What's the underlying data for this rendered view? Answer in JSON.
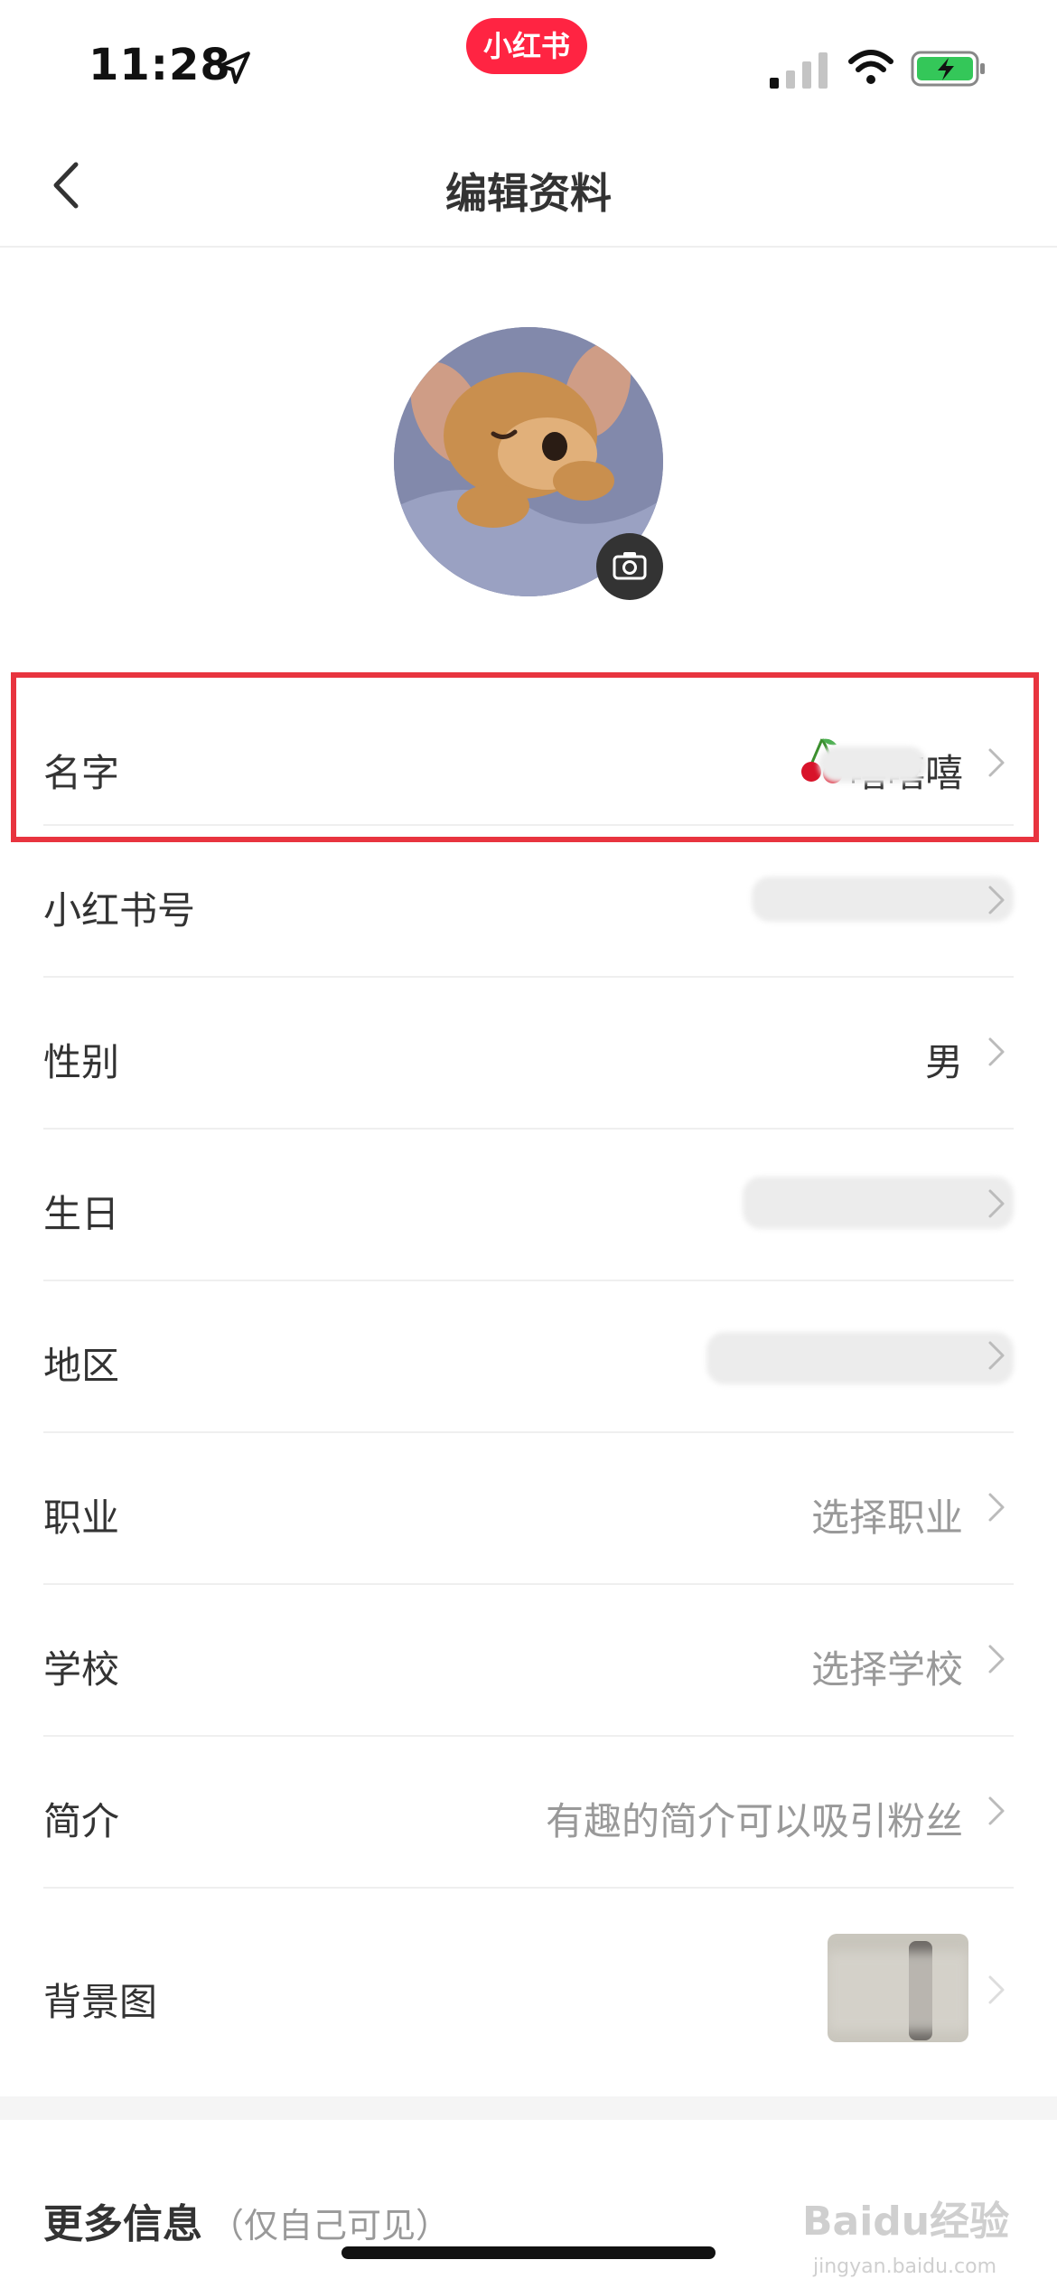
{
  "status_bar": {
    "time": "11:28",
    "app_badge": "小红书"
  },
  "nav": {
    "title": "编辑资料"
  },
  "rows": [
    {
      "label": "名字",
      "value": "嘻嘻嘻"
    },
    {
      "label": "小红书号",
      "value": ""
    },
    {
      "label": "性别",
      "value": "男"
    },
    {
      "label": "生日",
      "value": ""
    },
    {
      "label": "地区",
      "value": ""
    },
    {
      "label": "职业",
      "value": "选择职业"
    },
    {
      "label": "学校",
      "value": "选择学校"
    },
    {
      "label": "简介",
      "value": "有趣的简介可以吸引粉丝"
    },
    {
      "label": "背景图",
      "value": ""
    }
  ],
  "more_info": {
    "title": "更多信息",
    "subtitle": "（仅自己可见）"
  },
  "watermark": {
    "brand": "Baidu经验",
    "url": "jingyan.baidu.com"
  },
  "colors": {
    "accent": "#ff2442",
    "highlight_border": "#e8343f",
    "placeholder": "#999999"
  },
  "icons": [
    "location-arrow-icon",
    "signal-icon",
    "wifi-icon",
    "battery-charging-icon",
    "back-chevron-icon",
    "camera-icon",
    "chevron-right-icon",
    "cherry-emoji-icon"
  ]
}
